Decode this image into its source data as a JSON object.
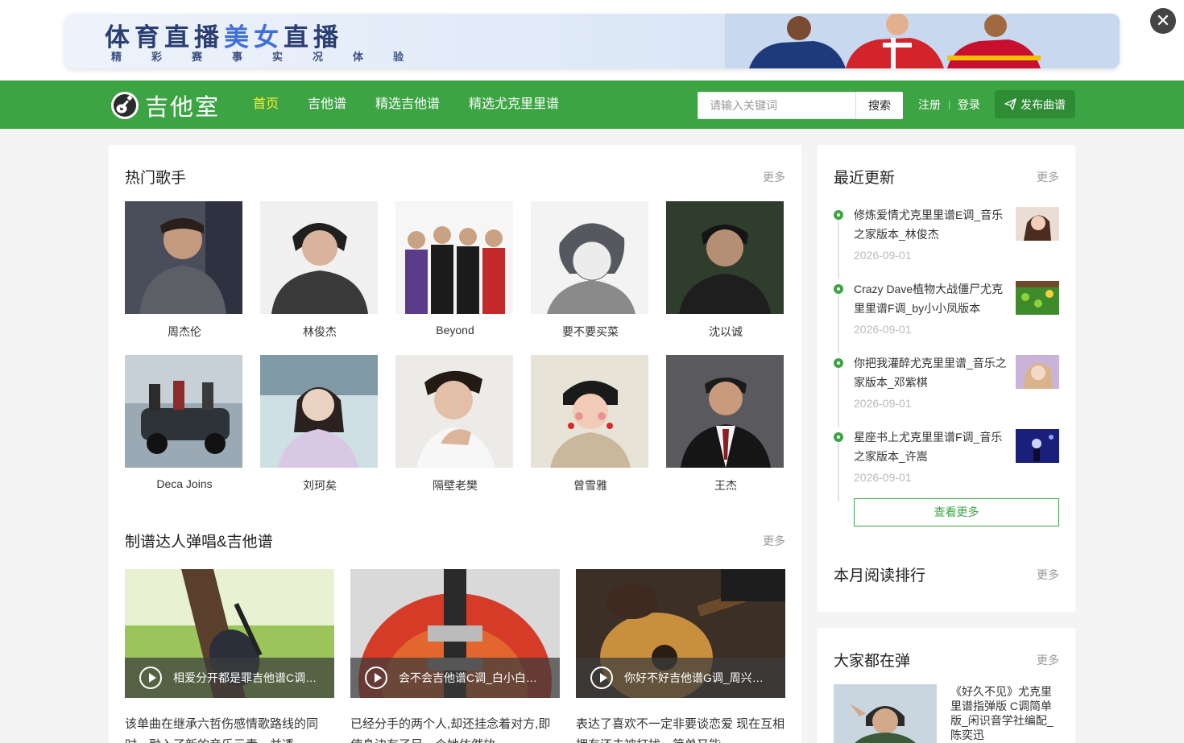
{
  "ad": {
    "title_part1": "体育直播",
    "title_part2": "美女",
    "title_part3": "直播",
    "subtitle": "精彩赛事实况体验",
    "close_label": "✕"
  },
  "nav": {
    "logo_text": "吉他室",
    "menu": [
      {
        "label": "首页",
        "active": true
      },
      {
        "label": "吉他谱",
        "active": false
      },
      {
        "label": "精选吉他谱",
        "active": false
      },
      {
        "label": "精选尤克里里谱",
        "active": false
      }
    ],
    "search_placeholder": "请输入关键词",
    "search_button": "搜索",
    "register": "注册",
    "separator": "|",
    "login": "登录",
    "publish": "发布曲谱"
  },
  "hot_singers": {
    "title": "热门歌手",
    "more": "更多",
    "items": [
      {
        "name": "周杰伦"
      },
      {
        "name": "林俊杰"
      },
      {
        "name": "Beyond"
      },
      {
        "name": "要不要买菜"
      },
      {
        "name": "沈以诚"
      },
      {
        "name": "Deca Joins"
      },
      {
        "name": "刘珂矣"
      },
      {
        "name": "隔壁老樊"
      },
      {
        "name": "曾雪雅"
      },
      {
        "name": "王杰"
      }
    ]
  },
  "experts": {
    "title": "制谱达人弹唱&吉他谱",
    "more": "更多",
    "items": [
      {
        "title": "相爱分开都是罪吉他谱C调_高音质…",
        "desc": "该单曲在继承六哲伤感情歌路线的同时，融入了新的音乐元素，并透"
      },
      {
        "title": "会不会吉他谱C调_白小白版本",
        "desc": "已经分手的两个人,却还挂念着对方,即使身边有了另一个她依然放"
      },
      {
        "title": "你好不好吉他谱G调_周兴哲版本",
        "desc": "表达了喜欢不一定非要谈恋爱 现在互相拥有还未被打扰，简单又能"
      }
    ]
  },
  "recent": {
    "title": "最近更新",
    "more": "更多",
    "items": [
      {
        "title": "修炼爱情尤克里里谱E调_音乐之家版本_林俊杰",
        "date": "2026-09-01"
      },
      {
        "title": "Crazy Dave植物大战僵尸尤克里里谱F调_by小小凤版本",
        "date": "2026-09-01"
      },
      {
        "title": "你把我灌醉尤克里里谱_音乐之家版本_邓紫棋",
        "date": "2026-09-01"
      },
      {
        "title": "星座书上尤克里里谱F调_音乐之家版本_许嵩",
        "date": "2026-09-01"
      }
    ],
    "view_more": "查看更多"
  },
  "monthly": {
    "title": "本月阅读排行",
    "more": "更多"
  },
  "everyone": {
    "title": "大家都在弹",
    "more": "更多",
    "item_title": "《好久不见》尤克里里谱指弹版 C调简单版_闲识音学社编配_陈奕迅"
  },
  "colors": {
    "brand_green": "#3da444",
    "active_menu": "#ffeb3b"
  }
}
